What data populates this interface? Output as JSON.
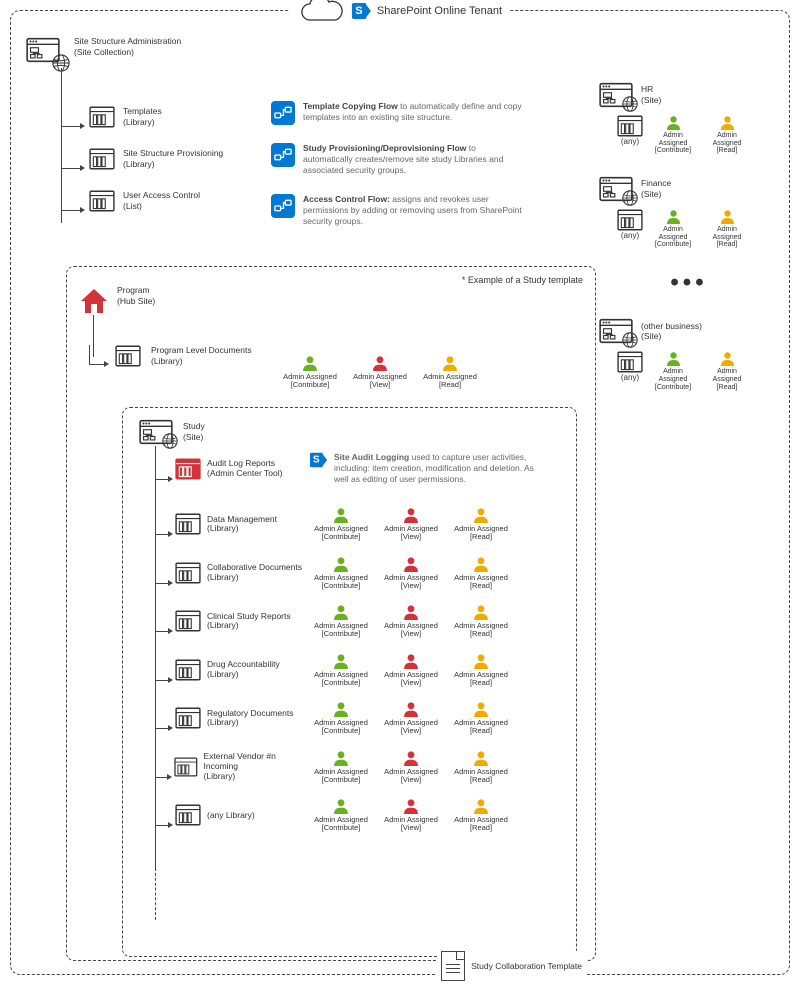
{
  "tenant": {
    "title": "SharePoint Online Tenant"
  },
  "admin": {
    "title": "Site Structure Administration",
    "subtitle": "(Site Collection)",
    "children": [
      {
        "name": "Templates",
        "sub": "(Library)"
      },
      {
        "name": "Site Structure Provisioning",
        "sub": "(Library)"
      },
      {
        "name": "User Access Control",
        "sub": "(List)"
      }
    ]
  },
  "flows": [
    {
      "title": "Template Copying Flow",
      "desc": " to automatically define and copy templates into an existing site structure."
    },
    {
      "title": "Study Provisioning/Deprovisioning Flow",
      "desc": " to automatically creates/remove site study Libraries and associated security groups."
    },
    {
      "title": "Access Control Flow:",
      "desc": "  assigns and revokes user permissions by adding or removing users from SharePoint security groups."
    }
  ],
  "right_sites": [
    {
      "name": "HR",
      "sub": "(Site)"
    },
    {
      "name": "Finance",
      "sub": "(Site)"
    },
    {
      "name": "(other business)",
      "sub": "(Site)"
    }
  ],
  "any_label": "(any)",
  "perm_contribute": {
    "label": "Admin Assigned",
    "role": "[Contribute]"
  },
  "perm_view": {
    "label": "Admin Assigned",
    "role": "[View]"
  },
  "perm_read": {
    "label": "Admin Assigned",
    "role": "[Read]"
  },
  "program": {
    "note": "* Example of a Study template",
    "title": "Program",
    "subtitle": "(Hub Site)",
    "docs": {
      "name": "Program Level Documents",
      "sub": "(Library)"
    }
  },
  "study": {
    "title": "Study",
    "subtitle": "(Site)",
    "audit": {
      "name": "Audit Log Reports",
      "sub": "(Admin Center Tool)",
      "desc_title": "Site Audit Logging",
      "desc": " used to capture user activities, including: item creation, modification and deletion. As well as editing of user permissions."
    },
    "items": [
      {
        "name": "Data Management",
        "sub": "(Library)"
      },
      {
        "name": "Collaborative Documents",
        "sub": "(Library)"
      },
      {
        "name": "Clinical Study Reports",
        "sub": "(Library)"
      },
      {
        "name": "Drug Accountability",
        "sub": "(Library)"
      },
      {
        "name": "Regulatory Documents",
        "sub": "(Library)"
      },
      {
        "name": "External Vendor #n Incoming",
        "sub": "(Library)"
      },
      {
        "name": "(any Library)",
        "sub": ""
      }
    ]
  },
  "template_label": "Study Collaboration Template",
  "colors": {
    "green": "#6ab023",
    "red": "#d13438",
    "amber": "#f0ab00",
    "blue": "#0078d4",
    "ink": "#333333"
  }
}
